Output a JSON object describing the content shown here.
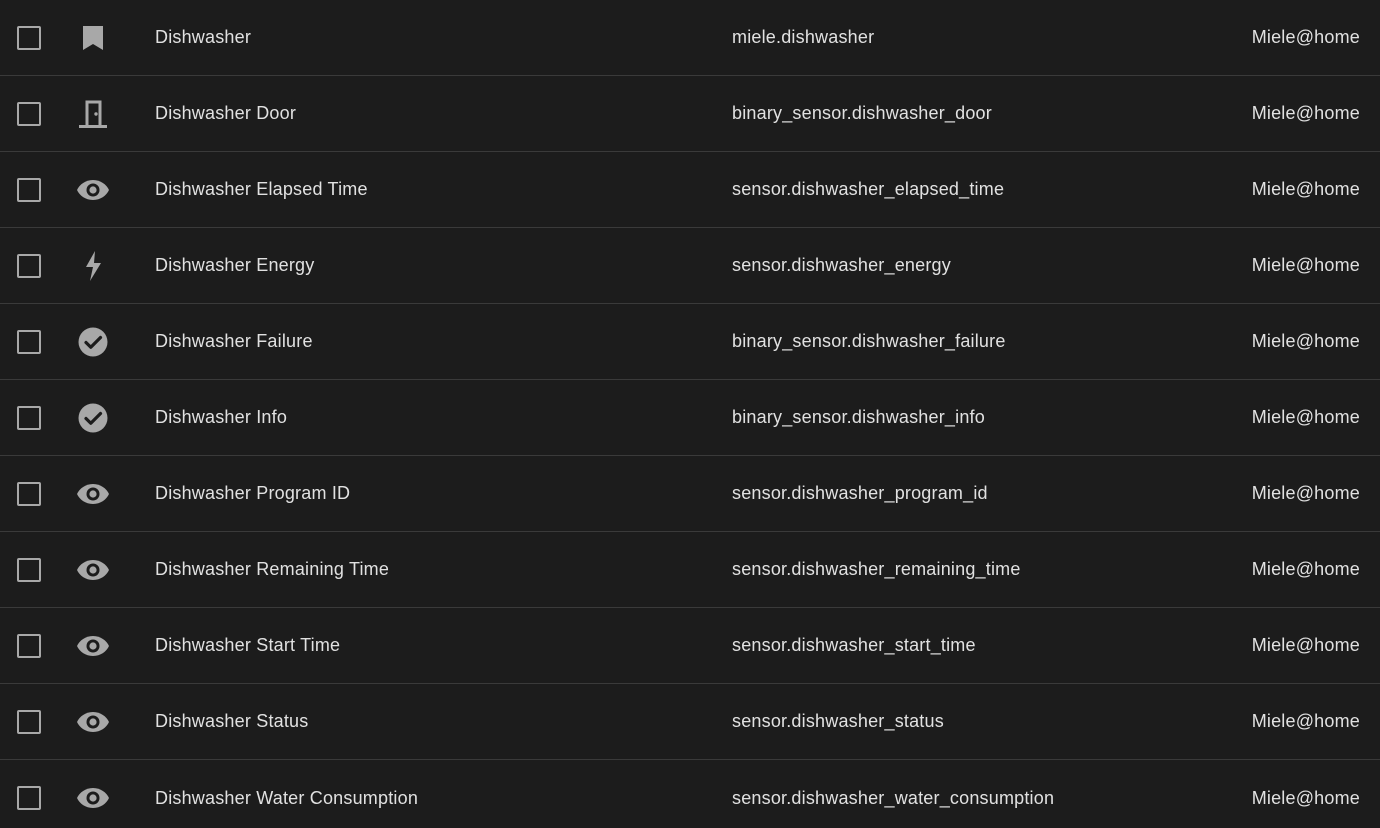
{
  "colors": {
    "background": "#1c1c1c",
    "divider": "#3a3a3a",
    "text": "#e1e1e1",
    "icon": "#a8a8a8"
  },
  "rows": [
    {
      "name": "Dishwasher",
      "entity_id": "miele.dishwasher",
      "integration": "Miele@home",
      "icon": "bookmark-icon"
    },
    {
      "name": "Dishwasher Door",
      "entity_id": "binary_sensor.dishwasher_door",
      "integration": "Miele@home",
      "icon": "door-icon"
    },
    {
      "name": "Dishwasher Elapsed Time",
      "entity_id": "sensor.dishwasher_elapsed_time",
      "integration": "Miele@home",
      "icon": "eye-icon"
    },
    {
      "name": "Dishwasher Energy",
      "entity_id": "sensor.dishwasher_energy",
      "integration": "Miele@home",
      "icon": "flash-icon"
    },
    {
      "name": "Dishwasher Failure",
      "entity_id": "binary_sensor.dishwasher_failure",
      "integration": "Miele@home",
      "icon": "check-circle-icon"
    },
    {
      "name": "Dishwasher Info",
      "entity_id": "binary_sensor.dishwasher_info",
      "integration": "Miele@home",
      "icon": "check-circle-icon"
    },
    {
      "name": "Dishwasher Program ID",
      "entity_id": "sensor.dishwasher_program_id",
      "integration": "Miele@home",
      "icon": "eye-icon"
    },
    {
      "name": "Dishwasher Remaining Time",
      "entity_id": "sensor.dishwasher_remaining_time",
      "integration": "Miele@home",
      "icon": "eye-icon"
    },
    {
      "name": "Dishwasher Start Time",
      "entity_id": "sensor.dishwasher_start_time",
      "integration": "Miele@home",
      "icon": "eye-icon"
    },
    {
      "name": "Dishwasher Status",
      "entity_id": "sensor.dishwasher_status",
      "integration": "Miele@home",
      "icon": "eye-icon"
    },
    {
      "name": "Dishwasher Water Consumption",
      "entity_id": "sensor.dishwasher_water_consumption",
      "integration": "Miele@home",
      "icon": "eye-icon"
    }
  ]
}
